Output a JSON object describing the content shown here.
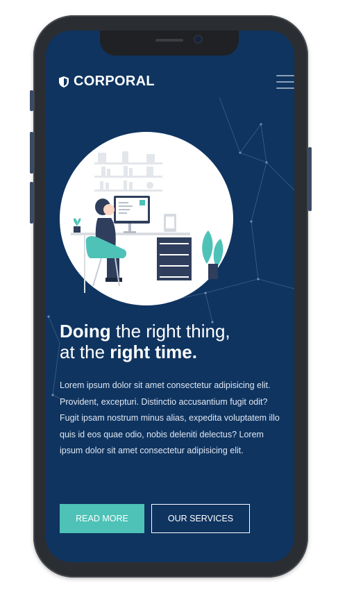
{
  "brand": {
    "name": "CORPORAL",
    "logo_icon": "shield-icon"
  },
  "nav": {
    "menu_icon": "hamburger-menu-icon"
  },
  "hero": {
    "headline_bold_1": "Doing",
    "headline_light_1": " the right thing,",
    "headline_light_2": "at the ",
    "headline_bold_2": "right time.",
    "paragraph": "Lorem ipsum dolor sit amet consectetur adipisicing elit. Provident, excepturi. Distinctio accusantium fugit odit? Fugit ipsam nostrum minus alias, expedita voluptatem illo quis id eos quae odio, nobis deleniti delectus? Lorem ipsum dolor sit amet consectetur adipisicing elit."
  },
  "buttons": {
    "read_more": "READ MORE",
    "our_services": "OUR SERVICES"
  },
  "colors": {
    "background": "#0f3460",
    "accent": "#4ec2b7",
    "text": "#ffffff"
  }
}
